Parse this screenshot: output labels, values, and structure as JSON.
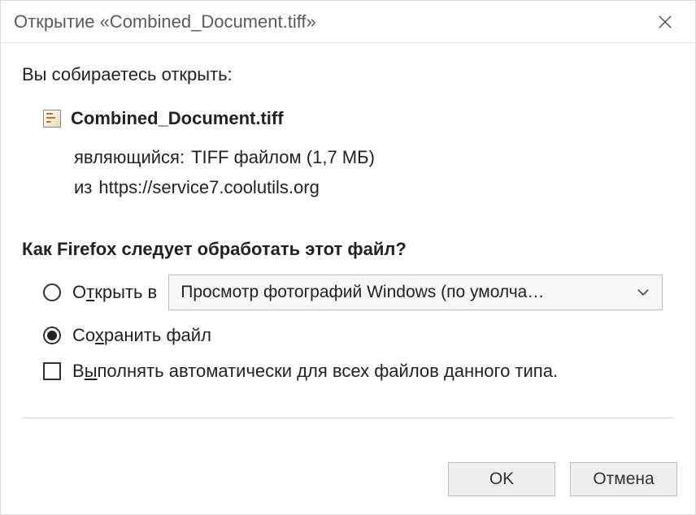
{
  "title": "Открытие «Combined_Document.tiff»",
  "intro": "Вы собираетесь открыть:",
  "file": {
    "name": "Combined_Document.tiff",
    "type_label": "являющийся:",
    "type_value": "TIFF файлом (1,7 МБ)",
    "from_label": "из",
    "from_value": "https://service7.coolutils.org"
  },
  "question": "Как Firefox следует обработать этот файл?",
  "options": {
    "open_with_pre": "О",
    "open_with_u": "т",
    "open_with_post": "крыть в",
    "app_selected": "Просмотр фотографий Windows (по умолча…",
    "save_pre": "Со",
    "save_u": "х",
    "save_post": "ранить файл"
  },
  "checkbox": {
    "pre": "В",
    "u": "ы",
    "post": "полнять автоматически для всех файлов данного типа."
  },
  "buttons": {
    "ok": "OK",
    "cancel": "Отмена"
  }
}
